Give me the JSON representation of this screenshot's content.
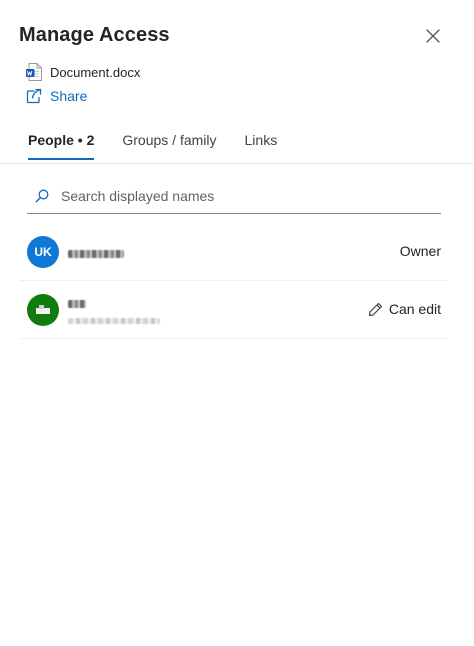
{
  "panel": {
    "title": "Manage Access",
    "close_icon": "close-icon"
  },
  "file": {
    "name": "Document.docx",
    "icon": "word-doc-icon"
  },
  "share": {
    "label": "Share",
    "icon": "share-icon"
  },
  "tabs": [
    {
      "label": "People • 2",
      "active": true
    },
    {
      "label": "Groups / family",
      "active": false
    },
    {
      "label": "Links",
      "active": false
    }
  ],
  "search": {
    "placeholder": "Search displayed names",
    "value": "",
    "icon": "search-icon"
  },
  "people": [
    {
      "initials": "UK",
      "avatar_color": "#0f78d4",
      "role": "Owner",
      "role_icon": ""
    },
    {
      "initials": "",
      "avatar_color": "#107c10",
      "role": "Can edit",
      "role_icon": "pencil-icon"
    }
  ],
  "colors": {
    "accent": "#0f6cbd"
  }
}
